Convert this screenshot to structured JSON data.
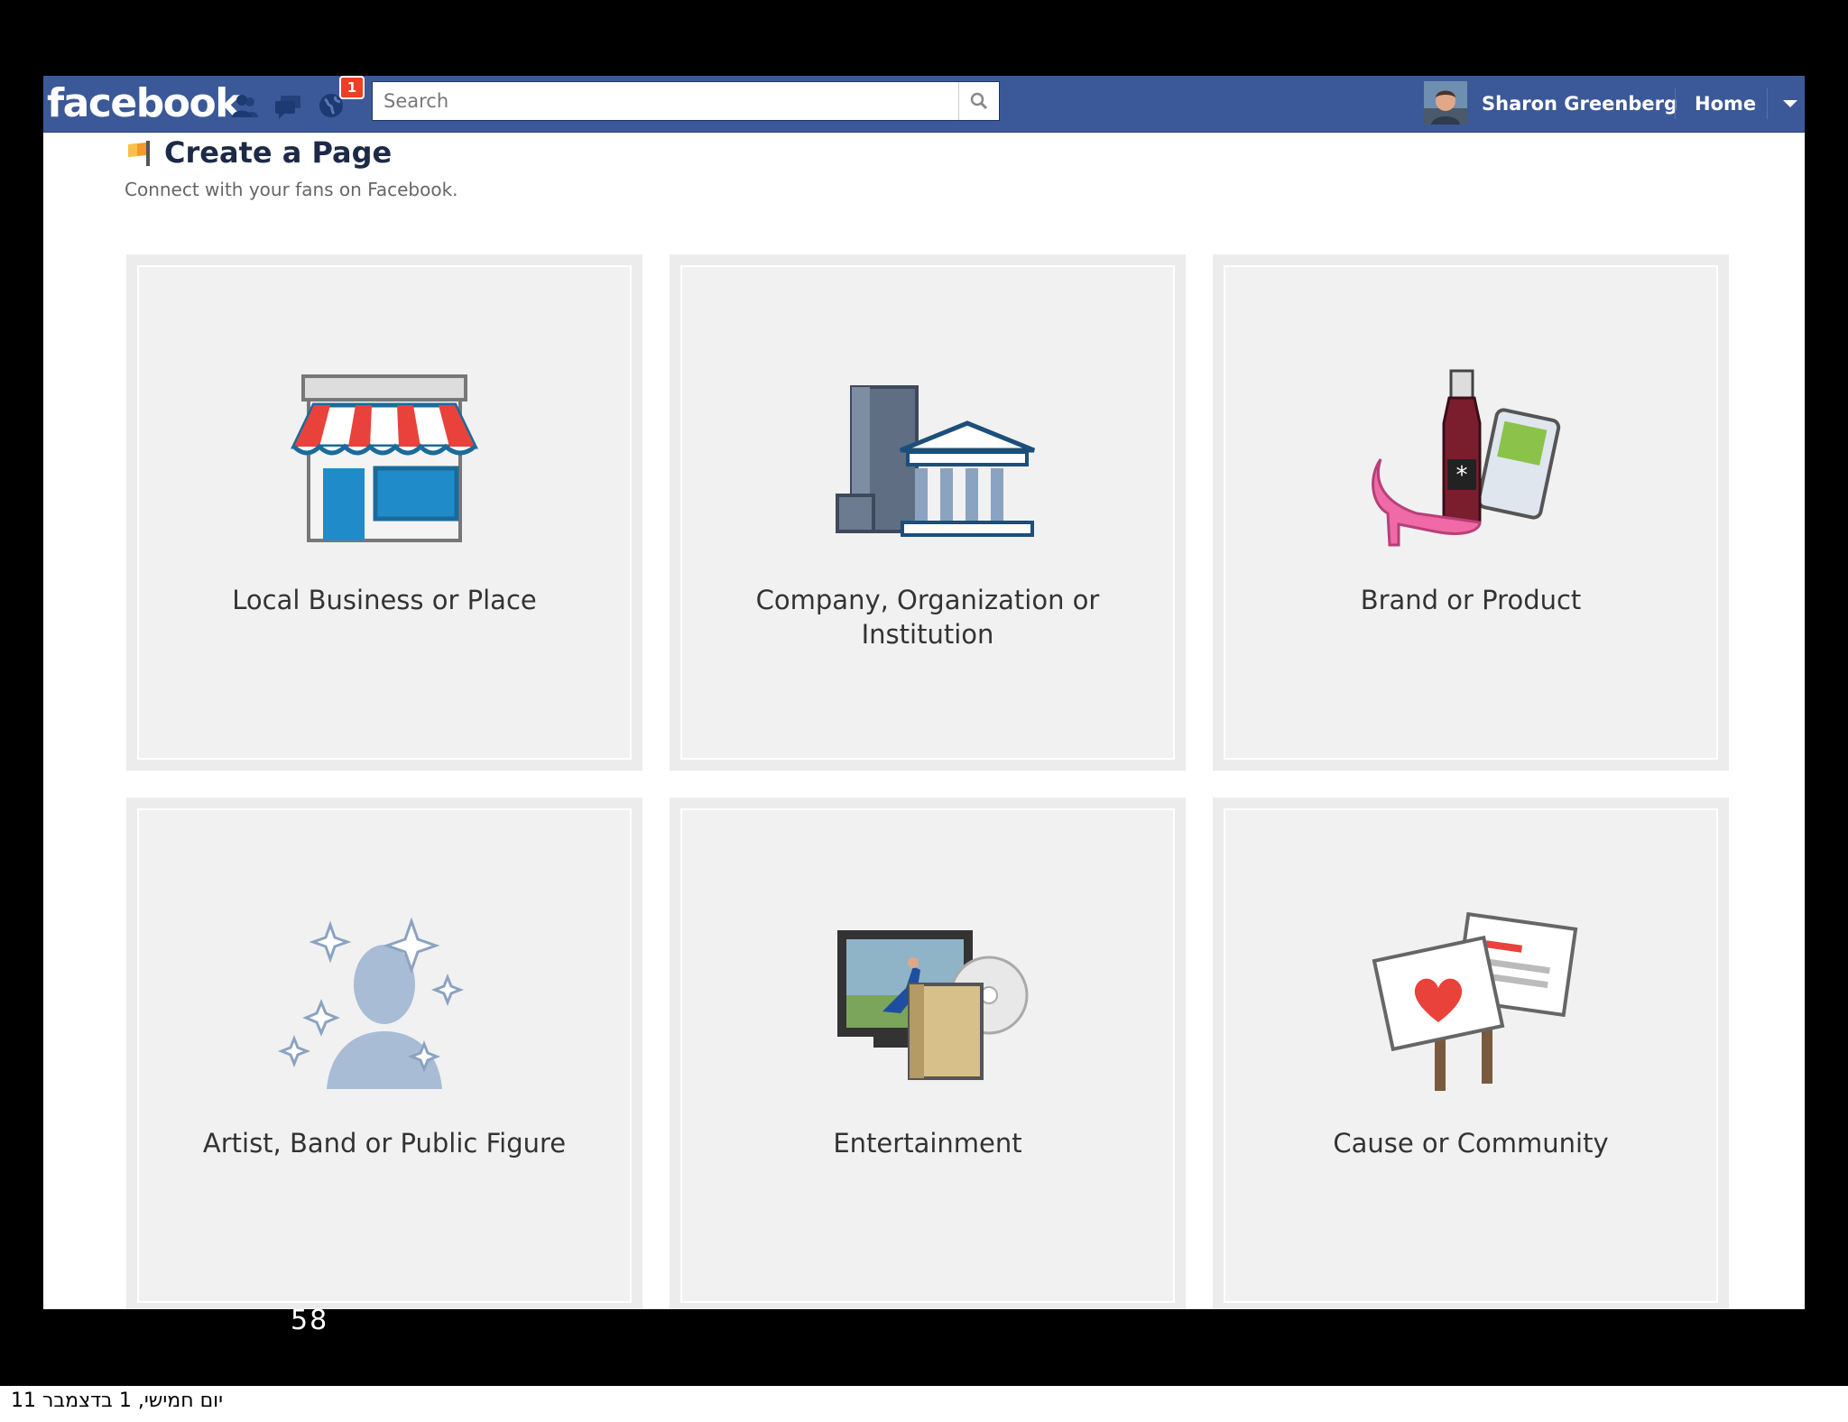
{
  "header": {
    "logo": "facebook",
    "notification_count": "1",
    "search": {
      "placeholder": "Search"
    },
    "user_name": "Sharon Greenberg",
    "home_label": "Home"
  },
  "page": {
    "title": "Create a Page",
    "subtitle": "Connect with your fans on Facebook."
  },
  "categories": [
    {
      "label": "Local Business or Place",
      "icon": "storefront-icon"
    },
    {
      "label": "Company, Organization or Institution",
      "icon": "buildings-icon"
    },
    {
      "label": "Brand or Product",
      "icon": "products-icon"
    },
    {
      "label": "Artist, Band or Public Figure",
      "icon": "silhouette-icon"
    },
    {
      "label": "Entertainment",
      "icon": "tv-dvd-book-icon"
    },
    {
      "label": "Cause or Community",
      "icon": "protest-signs-icon"
    }
  ],
  "colors": {
    "brand_blue": "#3b5998",
    "badge_red": "#f03d25",
    "tile_bg": "#f1f1f1"
  },
  "slide": {
    "number": "58",
    "date": "יום חמישי, 1 בדצמבר 11"
  }
}
